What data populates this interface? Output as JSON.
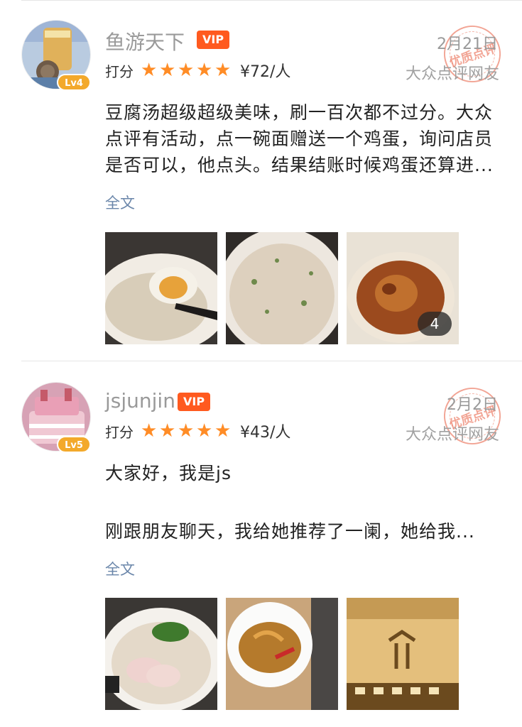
{
  "reviews": [
    {
      "username": "鱼游天下",
      "vip_label": "VIP",
      "level": "Lv4",
      "date": "2月21日",
      "stamp_text": "优质点评",
      "rating_label": "打分",
      "stars": 5,
      "price": "¥72/人",
      "source": "大众点评网友",
      "text": "豆腐汤超级超级美味，刷一百次都不过分。大众点评有活动，点一碗面赠送一个鸡蛋，询问店员是否可以，他点头。结果结账时候鸡蛋还算进...",
      "fulltext_label": "全文",
      "photo_count": "4"
    },
    {
      "username": "jsjunjin",
      "vip_label": "VIP",
      "level": "Lv5",
      "date": "2月2日",
      "stamp_text": "优质点评",
      "rating_label": "打分",
      "stars": 5,
      "price": "¥43/人",
      "source": "大众点评网友",
      "text_line1": "大家好，我是js",
      "text_line2": "刚跟朋友聊天，我给她推荐了一阑，她给我...",
      "fulltext_label": "全文"
    }
  ],
  "colors": {
    "accent_orange": "#ff5a1f",
    "star_orange": "#ff8c26",
    "link_blue": "#6a86aa",
    "level_badge": "#f3a92b"
  }
}
